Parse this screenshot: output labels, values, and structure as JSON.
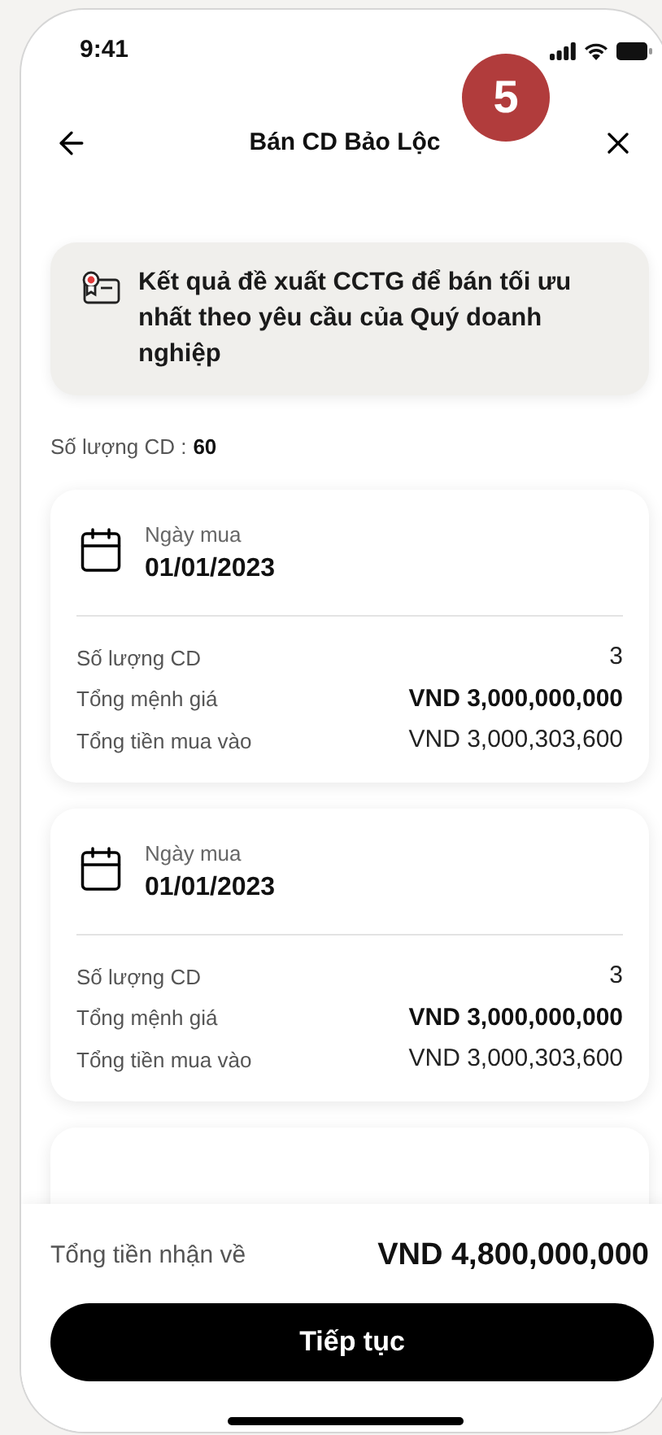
{
  "status_bar": {
    "time": "9:41"
  },
  "step_badge": "5",
  "header": {
    "title": "Bán CD Bảo Lộc"
  },
  "info_banner": "Kết quả đề xuất CCTG để bán tối ưu nhất theo yêu cầu của Quý doanh nghiệp",
  "summary": {
    "label": "Số lượng CD :",
    "value": "60"
  },
  "cards": [
    {
      "date_label": "Ngày mua",
      "date": "01/01/2023",
      "rows": [
        {
          "label": "Số lượng CD",
          "value": "3",
          "bold": false
        },
        {
          "label": "Tổng mệnh giá",
          "value": "VND 3,000,000,000",
          "bold": true
        },
        {
          "label": "Tổng tiền mua vào",
          "value": "VND 3,000,303,600",
          "bold": false
        }
      ]
    },
    {
      "date_label": "Ngày mua",
      "date": "01/01/2023",
      "rows": [
        {
          "label": "Số lượng CD",
          "value": "3",
          "bold": false
        },
        {
          "label": "Tổng mệnh giá",
          "value": "VND 3,000,000,000",
          "bold": true
        },
        {
          "label": "Tổng tiền mua vào",
          "value": "VND 3,000,303,600",
          "bold": false
        }
      ]
    }
  ],
  "footer": {
    "total_label": "Tổng tiền nhận về",
    "total_value": "VND 4,800,000,000",
    "button": "Tiếp tục"
  }
}
